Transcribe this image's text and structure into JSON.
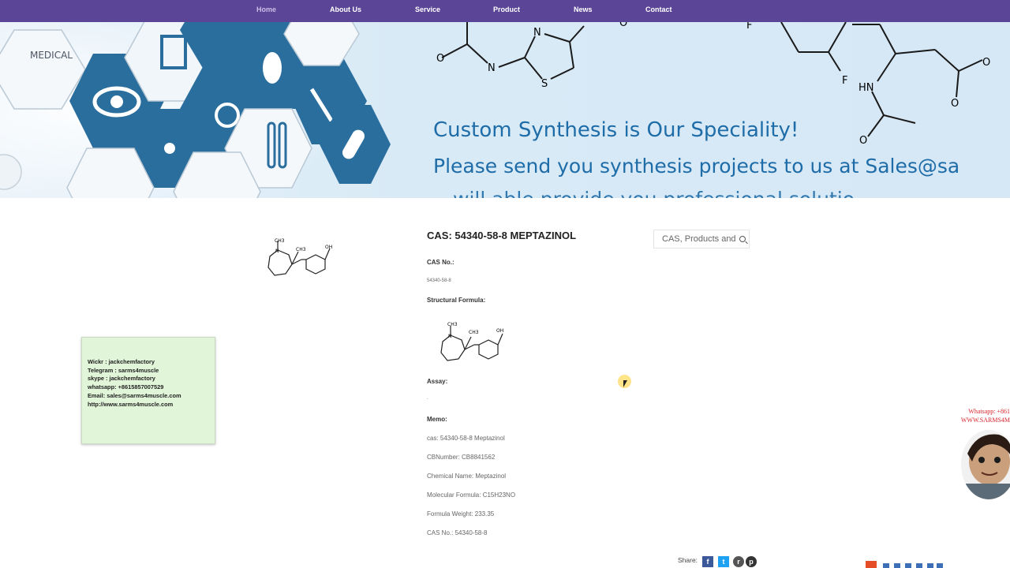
{
  "nav": {
    "items": [
      {
        "label": "Home",
        "active": true
      },
      {
        "label": "About Us"
      },
      {
        "label": "Service"
      },
      {
        "label": "Product"
      },
      {
        "label": "News"
      },
      {
        "label": "Contact"
      }
    ]
  },
  "banner": {
    "hex_label": "MEDICAL",
    "line1": "Custom Synthesis is Our Speciality!",
    "line2": "Please send you synthesis projects to us at Sales@sa",
    "line3": "…will able provide you professional solutio",
    "chem_labels": {
      "n": "N",
      "s": "S",
      "f": "F",
      "hn": "HN",
      "o": "O"
    }
  },
  "product": {
    "title": "CAS: 54340-58-8 MEPTAZINOL",
    "cas_label": "CAS No.:",
    "cas_value": "54340-58-8",
    "formula_label": "Structural Formula:",
    "assay_label": "Assay:",
    "assay_value": ".",
    "memo_label": "Memo:",
    "memo": [
      "cas: 54340-58-8  Meptazinol",
      "CBNumber: CB8841562",
      "Chemical Name: Meptazinol",
      "Molecular Formula: C15H23NO",
      "Formula Weight: 233.35",
      "CAS No.: 54340-58-8"
    ],
    "structure_labels": {
      "ch3a": "CH3",
      "ch3b": "CH3",
      "n": "N",
      "oh": "OH"
    }
  },
  "search": {
    "placeholder": "CAS, Products and"
  },
  "contact": {
    "lines": [
      "Wickr : jackchemfactory",
      "Telegram :  sarms4muscle",
      "skype :  jackchemfactory",
      "whatsapp: +8615857007529",
      "Email: sales@sarms4muscle.com",
      "http://www.sarms4muscle.com"
    ]
  },
  "share": {
    "label": "Share:",
    "fb": "f",
    "tw": "t",
    "rd": "r",
    "pt": "p"
  },
  "floating": {
    "whatsapp": "Whatsapp: +861",
    "site": "WWW.SARMS4M"
  },
  "colors": {
    "nav": "#5b4597",
    "banner_text": "#1e6ca8",
    "hex_blue": "#2a6e9e",
    "red": "#d6262d"
  }
}
